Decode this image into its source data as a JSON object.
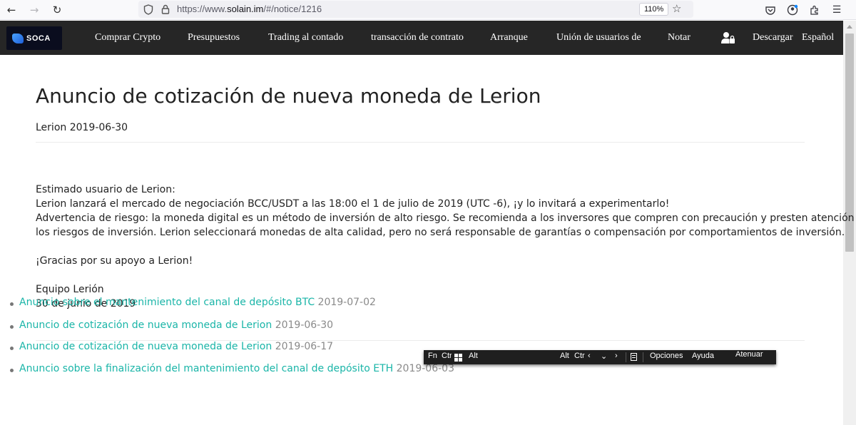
{
  "browser": {
    "url_scheme": "https://www.",
    "url_host": "solain.im",
    "url_path": "/#/notice/1216",
    "zoom": "110%"
  },
  "site": {
    "logo_text": "SOCA",
    "nav": [
      "Comprar Crypto",
      "Presupuestos",
      "Trading al contado",
      "transacción de contrato",
      "Arranque",
      "Unión de usuarios de",
      "Notar"
    ],
    "download": "Descargar",
    "language": "Español"
  },
  "notice": {
    "title": "Anuncio de cotización de nueva moneda de Lerion",
    "meta": "Lerion 2019-06-30",
    "body": [
      "Estimado usuario de Lerion:",
      "Lerion lanzará el mercado de negociación BCC/USDT a las 18:00 el 1 de julio de 2019 (UTC -6), ¡y lo invitará a experimentarlo!",
      "Advertencia de riesgo: la moneda digital es un método de inversión de alto riesgo. Se recomienda a los inversores que compren con precaución y presten atención a",
      "los riesgos de inversión. Lerion seleccionará monedas de alta calidad, pero no será responsable de garantías o compensación por comportamientos de inversión.",
      "¡Gracias por su apoyo a Lerion!",
      "Equipo Lerión",
      "30 de junio de 2019"
    ]
  },
  "related": [
    {
      "title": "Anuncio sobre el mantenimiento del canal de depósito BTC",
      "date": "2019-07-02"
    },
    {
      "title": "Anuncio de cotización de nueva moneda de Lerion",
      "date": "2019-06-30"
    },
    {
      "title": "Anuncio de cotización de nueva moneda de Lerion",
      "date": "2019-06-17"
    },
    {
      "title": "Anuncio sobre la finalización del mantenimiento del canal de depósito ETH",
      "date": "2019-06-03"
    }
  ],
  "keyboard_toolbar": {
    "fn": "Fn",
    "ctrl": "Ctrl",
    "alt": "Alt",
    "alt_gr": "Alt",
    "ctrl_right": "Ctr",
    "options": "Opciones",
    "help": "Ayuda",
    "dim": "Atenuar"
  },
  "colors": {
    "header_bg": "#262626",
    "link": "#1ab5a8",
    "date": "#8a8a8a"
  }
}
